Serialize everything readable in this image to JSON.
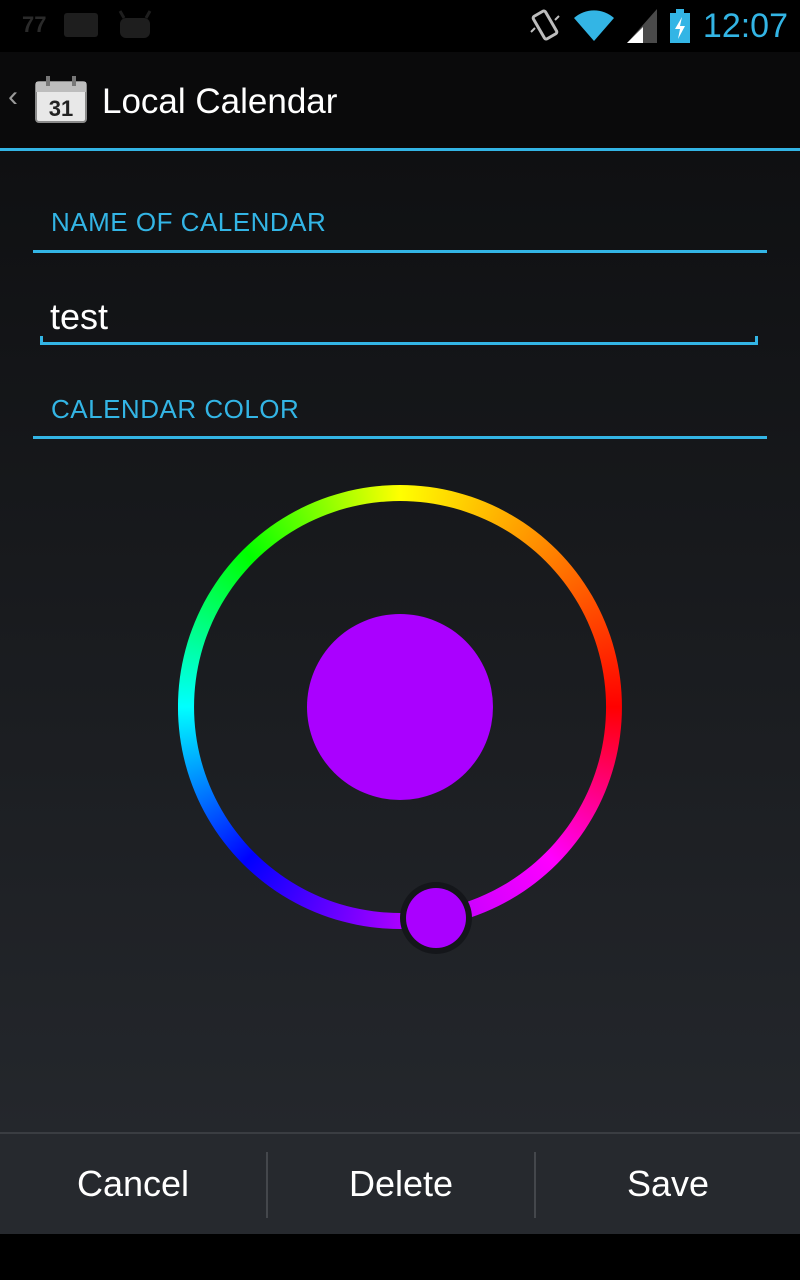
{
  "status_bar": {
    "notification_count": "77",
    "time": "12:07",
    "icons": [
      "picture-icon",
      "android-icon",
      "vibrate-icon",
      "wifi-icon",
      "signal-icon",
      "battery-charging-icon"
    ]
  },
  "action_bar": {
    "title": "Local Calendar",
    "app_icon_text": "31",
    "accent_color": "#33b5e5"
  },
  "form": {
    "name_section_label": "NAME OF CALENDAR",
    "name_value": "test",
    "color_section_label": "CALENDAR COLOR",
    "selected_color": "#aa00ff"
  },
  "buttons": {
    "cancel": "Cancel",
    "delete": "Delete",
    "save": "Save"
  }
}
